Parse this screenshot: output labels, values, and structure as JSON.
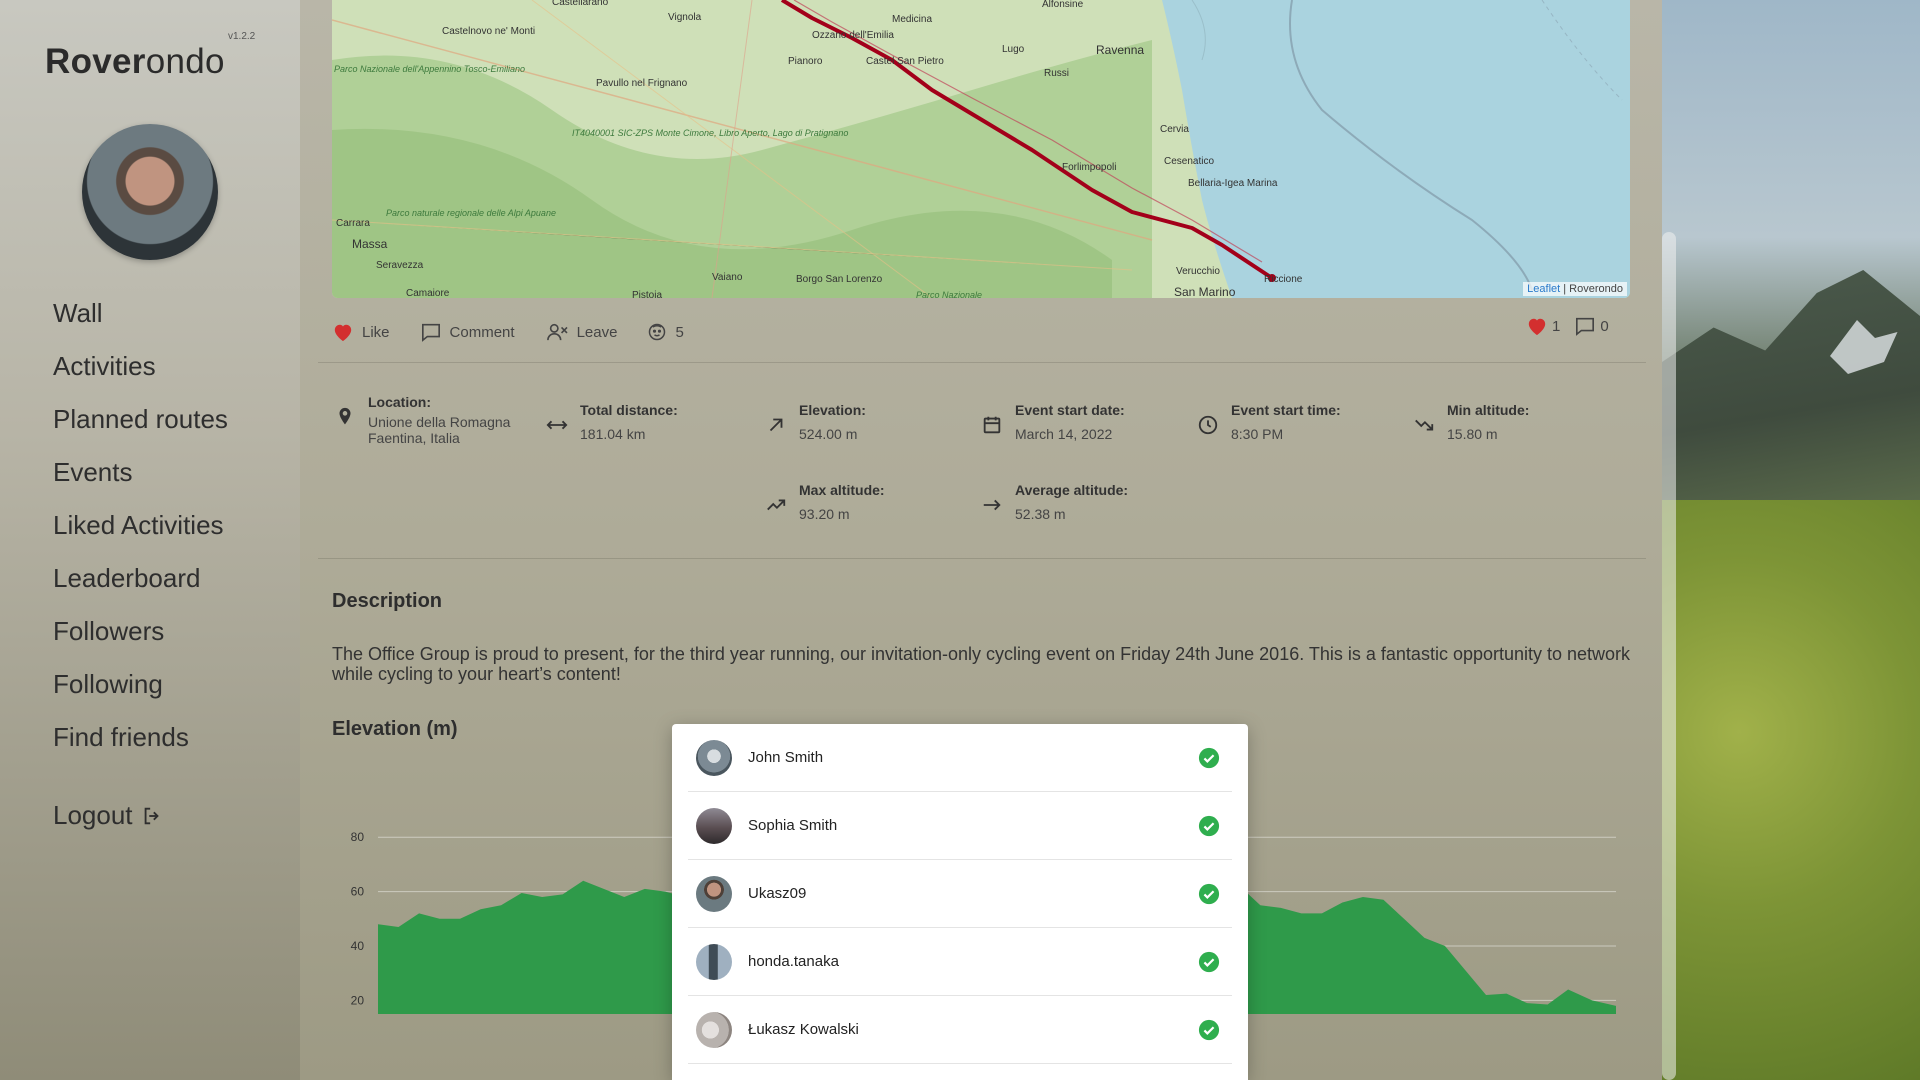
{
  "app": {
    "name_bold": "Rover",
    "name_rest": "ondo",
    "version": "v1.2.2"
  },
  "nav": {
    "items": [
      {
        "label": "Wall"
      },
      {
        "label": "Activities"
      },
      {
        "label": "Planned routes"
      },
      {
        "label": "Events"
      },
      {
        "label": "Liked Activities"
      },
      {
        "label": "Leaderboard"
      },
      {
        "label": "Followers"
      },
      {
        "label": "Following"
      },
      {
        "label": "Find friends"
      }
    ],
    "logout": "Logout"
  },
  "map": {
    "attribution_link": "Leaflet",
    "attribution_rest": " | Roverondo",
    "labels": {
      "castellarano": "Castellarano",
      "vignola": "Vignola",
      "medicina": "Medicina",
      "alfonsine": "Alfonsine",
      "castelnovo": "Castelnovo ne' Monti",
      "ozzano": "Ozzano dell'Emilia",
      "lugo": "Lugo",
      "ravenna": "Ravenna",
      "pianoro": "Pianoro",
      "castel_san_pietro": "Castel San Pietro",
      "russi": "Russi",
      "parco_appennino": "Parco Nazionale dell'Appennino Tosco-Emiliano",
      "pavullo": "Pavullo nel Frignano",
      "cervia": "Cervia",
      "it404": "IT4040001 SIC-ZPS Monte Cimone, Libro Aperto, Lago di Pratignano",
      "forlimpopoli": "Forlimpopoli",
      "cesenatico": "Cesenatico",
      "bellaria": "Bellaria-Igea Marina",
      "carrara": "Carrara",
      "parco_alpi": "Parco naturale regionale delle Alpi Apuane",
      "massa": "Massa",
      "seravezza": "Seravezza",
      "camaiore": "Camaiore",
      "vaiano": "Vaiano",
      "borgo": "Borgo San Lorenzo",
      "pistoia": "Pistoia",
      "verucchio": "Verucchio",
      "riccione": "Riccione",
      "san_marino": "San Marino",
      "parco_naz": "Parco Nazionale"
    }
  },
  "actions": {
    "like": "Like",
    "comment": "Comment",
    "leave": "Leave",
    "participants": "5",
    "likes_count": "1",
    "comments_count": "0"
  },
  "stats": {
    "location_label": "Location:",
    "location_line1": "Unione della Romagna",
    "location_line2": "Faentina, Italia",
    "distance_label": "Total distance:",
    "distance_value": "181.04 km",
    "elevation_label": "Elevation:",
    "elevation_value": "524.00 m",
    "start_date_label": "Event start date:",
    "start_date_value": "March 14, 2022",
    "start_time_label": "Event start time:",
    "start_time_value": "8:30 PM",
    "min_alt_label": "Min altitude:",
    "min_alt_value": "15.80 m",
    "max_alt_label": "Max altitude:",
    "max_alt_value": "93.20 m",
    "avg_alt_label": "Average altitude:",
    "avg_alt_value": "52.38 m"
  },
  "description": {
    "title": "Description",
    "text": "The Office Group is proud to present, for the third year running, our invitation-only cycling event on Friday 24th June 2016. This is a fantastic opportunity to network while cycling to your heart’s content!"
  },
  "elevation": {
    "title": "Elevation (m)"
  },
  "chart_data": {
    "type": "area",
    "title": "Elevation (m)",
    "xlabel": "",
    "ylabel": "",
    "ylim": [
      15,
      90
    ],
    "yticks": [
      20,
      40,
      60,
      80
    ],
    "grid": true,
    "series_color": "#2f9a4a",
    "x": [
      0,
      6,
      12,
      18,
      24,
      30,
      36,
      42,
      48,
      54,
      60,
      66,
      72,
      78,
      84,
      90,
      96,
      102,
      108,
      114,
      120,
      126,
      132,
      138,
      144,
      150,
      156,
      162,
      168,
      174,
      181
    ],
    "values": [
      48,
      52,
      50,
      55,
      58,
      64,
      58,
      60,
      62,
      56,
      64,
      60,
      57,
      55,
      54,
      56,
      52,
      58,
      60,
      55,
      57,
      62,
      54,
      52,
      58,
      50,
      40,
      22,
      19,
      24,
      18
    ]
  },
  "participants": [
    {
      "name": "John Smith",
      "avatar_color": "#7c8a94"
    },
    {
      "name": "Sophia Smith",
      "avatar_color": "#5a4e52"
    },
    {
      "name": "Ukasz09",
      "avatar_color": "#6b5a4c"
    },
    {
      "name": "honda.tanaka",
      "avatar_color": "#6f8294"
    },
    {
      "name": "Łukasz Kowalski",
      "avatar_color": "#b8b2ae"
    }
  ],
  "colors": {
    "accent_green": "#2fae4e",
    "heart_red": "#d32f2f",
    "route_red": "#a3001a"
  }
}
